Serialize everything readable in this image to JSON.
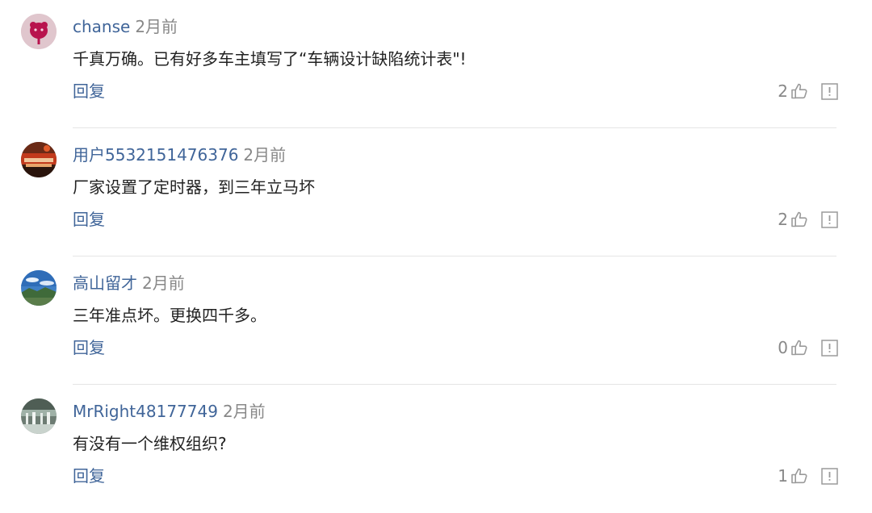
{
  "reply_label": "回复",
  "colors": {
    "link": "#406599",
    "muted": "#888888",
    "text": "#222222",
    "divider": "#e5e5e5"
  },
  "comments": [
    {
      "username": "chanse",
      "time": "2月前",
      "text": "千真万确。已有好多车主填写了“车辆设计缺陷统计表\"!",
      "likes": "2",
      "avatar": "pink-blob-avatar"
    },
    {
      "username": "用户5532151476376",
      "time": "2月前",
      "text": "厂家设置了定时器，到三年立马坏",
      "likes": "2",
      "avatar": "red-food-avatar"
    },
    {
      "username": "高山留才",
      "time": "2月前",
      "text": "三年准点坏。更换四千多。",
      "likes": "0",
      "avatar": "sky-landscape-avatar"
    },
    {
      "username": "MrRight48177749",
      "time": "2月前",
      "text": "有没有一个维权组织?",
      "likes": "1",
      "avatar": "waterfall-avatar"
    }
  ]
}
